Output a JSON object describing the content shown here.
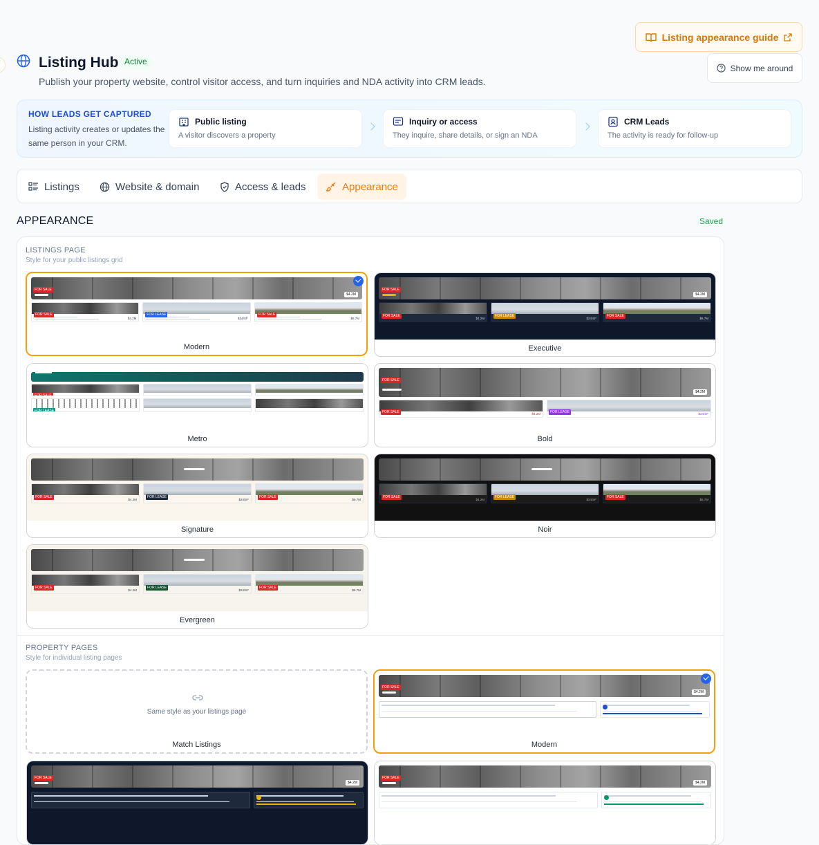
{
  "header": {
    "title": "Listing Hub",
    "status": "Active",
    "subtitle": "Publish your property website, control visitor access, and turn inquiries and NDA activity into CRM leads.",
    "guide_button": "Listing appearance guide",
    "tour_button": "Show me around"
  },
  "how_leads": {
    "heading": "HOW LEADS GET CAPTURED",
    "description": "Listing activity creates or updates the same person in your CRM.",
    "steps": [
      {
        "title": "Public listing",
        "desc": "A visitor discovers a property",
        "icon": "building-icon"
      },
      {
        "title": "Inquiry or access",
        "desc": "They inquire, share details, or sign an NDA",
        "icon": "message-icon"
      },
      {
        "title": "CRM Leads",
        "desc": "The activity is ready for follow-up",
        "icon": "contact-icon"
      }
    ]
  },
  "tabs": [
    {
      "label": "Listings",
      "icon": "list-icon"
    },
    {
      "label": "Website & domain",
      "icon": "globe-icon"
    },
    {
      "label": "Access & leads",
      "icon": "shield-icon"
    },
    {
      "label": "Appearance",
      "icon": "brush-icon",
      "selected": true
    }
  ],
  "appearance": {
    "title": "APPEARANCE",
    "status": "Saved",
    "listings_page": {
      "heading": "LISTINGS PAGE",
      "desc": "Style for your public listings grid",
      "selected": "Modern",
      "themes": [
        "Modern",
        "Executive",
        "Metro",
        "Bold",
        "Signature",
        "Noir",
        "Evergreen"
      ]
    },
    "property_pages": {
      "heading": "PROPERTY PAGES",
      "desc": "Style for individual listing pages",
      "selected": "Modern",
      "match_text": "Same style as your listings page",
      "themes": [
        "Match Listings",
        "Modern"
      ]
    },
    "preview": {
      "price": "$4.2M",
      "prices": [
        "$4.2M",
        "$24/SF",
        "$6.7M"
      ],
      "badges": [
        "FOR SALE",
        "FOR LEASE",
        "FOR SALE"
      ]
    }
  },
  "colors": {
    "accent": "#f59e0b",
    "brand_blue": "#2563eb",
    "success": "#16a34a"
  }
}
